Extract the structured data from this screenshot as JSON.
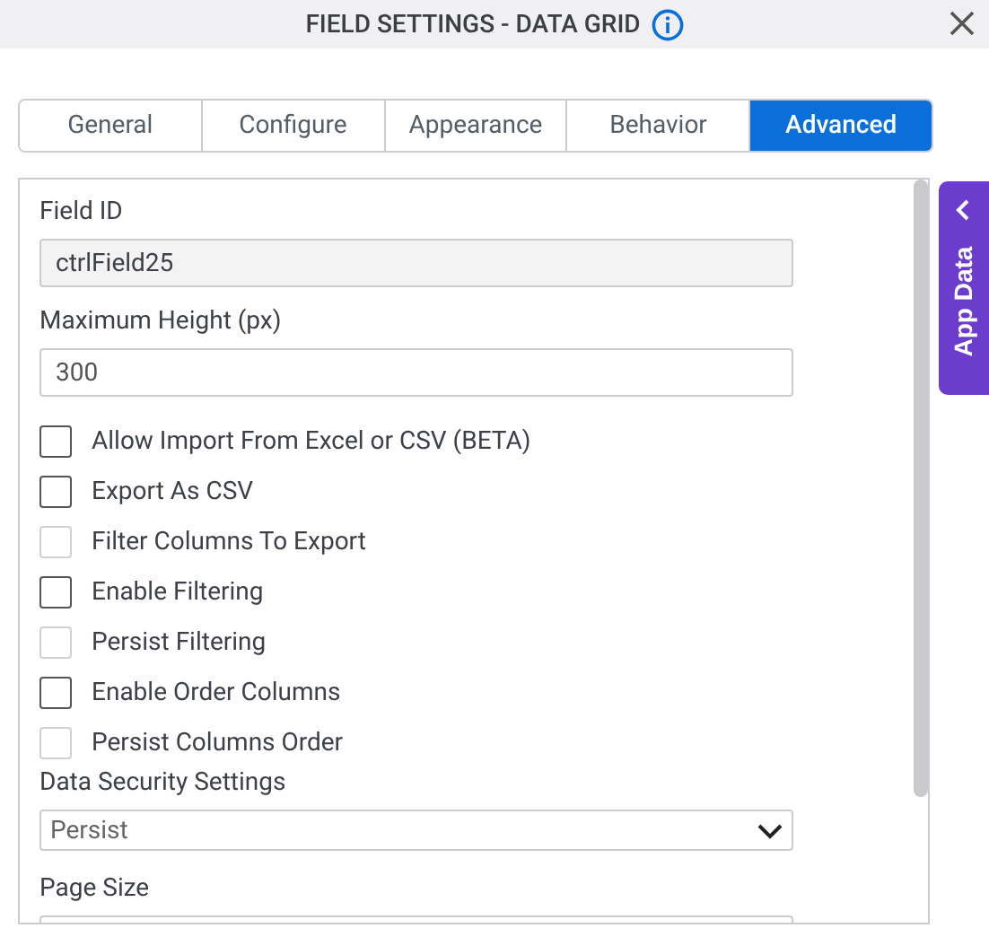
{
  "window": {
    "title": "FIELD SETTINGS - DATA GRID"
  },
  "tabs": [
    {
      "label": "General",
      "selected": false
    },
    {
      "label": "Configure",
      "selected": false
    },
    {
      "label": "Appearance",
      "selected": false
    },
    {
      "label": "Behavior",
      "selected": false
    },
    {
      "label": "Advanced",
      "selected": true
    }
  ],
  "side_tab": {
    "label": "App Data"
  },
  "fields": [
    {
      "kind": "text",
      "label": "Field ID",
      "value": "ctrlField25",
      "disabled": true
    },
    {
      "kind": "text",
      "label": "Maximum Height (px)",
      "value": "300",
      "disabled": false
    },
    {
      "kind": "checkbox",
      "label": "Allow Import From Excel or CSV (BETA)",
      "checked": false,
      "disabled": false
    },
    {
      "kind": "checkbox",
      "label": "Export As CSV",
      "checked": false,
      "disabled": false
    },
    {
      "kind": "checkbox",
      "label": "Filter Columns To Export",
      "checked": false,
      "disabled": true
    },
    {
      "kind": "checkbox",
      "label": "Enable Filtering",
      "checked": false,
      "disabled": false
    },
    {
      "kind": "checkbox",
      "label": "Persist Filtering",
      "checked": false,
      "disabled": true
    },
    {
      "kind": "checkbox",
      "label": "Enable Order Columns",
      "checked": false,
      "disabled": false
    },
    {
      "kind": "checkbox",
      "label": "Persist Columns Order",
      "checked": false,
      "disabled": true
    },
    {
      "kind": "select",
      "label": "Data Security Settings",
      "value": "Persist"
    },
    {
      "kind": "text",
      "label": "Page Size",
      "disabled": false
    }
  ]
}
